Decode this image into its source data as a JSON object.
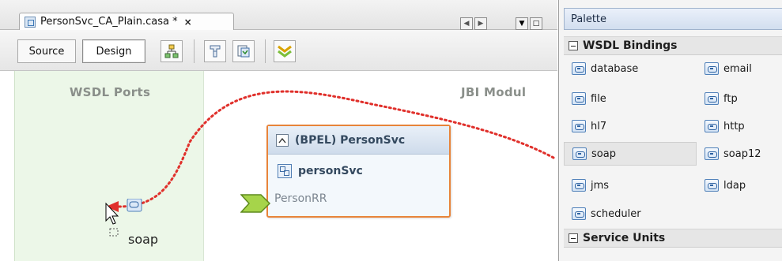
{
  "editor": {
    "tab_title": "PersonSvc_CA_Plain.casa *",
    "tab_close": "×",
    "nav_buttons": [
      "◀",
      "▶",
      "▼",
      "□"
    ],
    "view_tabs": [
      "Source",
      "Design"
    ],
    "toolbar_icons": [
      "hierarchy-icon",
      "build-icon",
      "deploy-icon",
      "expand-all-icon"
    ],
    "columns": {
      "wsdl_ports": "WSDL Ports",
      "jbi_modules": "JBI Modul"
    },
    "bpel_box": {
      "title": "(BPEL) PersonSvc",
      "service": "personSvc",
      "port": "PersonRR"
    },
    "drag_item": {
      "label": "soap"
    },
    "accent_colors": {
      "bpel_border": "#e8843a",
      "drag_arrow": "#e0302b",
      "consume_arrow": "#9cca3c",
      "wsdl_column": "#ecf7e8"
    }
  },
  "palette": {
    "title": "Palette",
    "categories": [
      {
        "name": "WSDL Bindings",
        "items": [
          [
            "database",
            "email"
          ],
          [
            "file",
            "ftp"
          ],
          [
            "hl7",
            "http"
          ],
          [
            "soap",
            "soap12"
          ],
          [
            "jms",
            "ldap"
          ],
          [
            "scheduler"
          ]
        ],
        "selected": "soap"
      },
      {
        "name": "Service Units"
      }
    ]
  }
}
